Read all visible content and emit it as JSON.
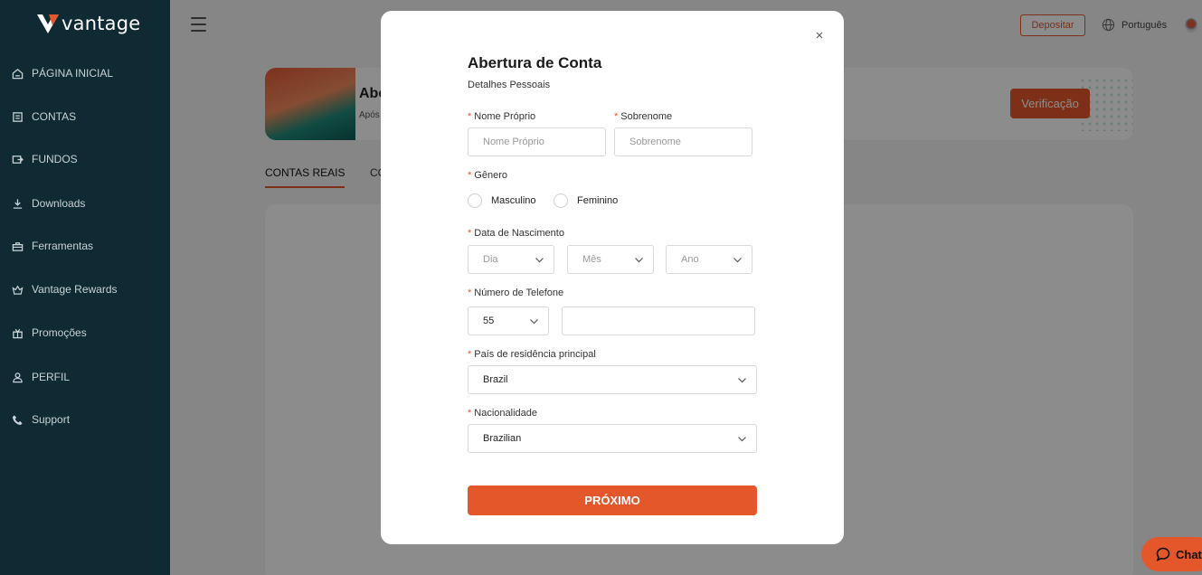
{
  "brand": {
    "name": "vantage"
  },
  "sidebar": {
    "items": [
      {
        "label": "PÁGINA INICIAL",
        "icon": "home-icon"
      },
      {
        "label": "CONTAS",
        "icon": "accounts-icon"
      },
      {
        "label": "FUNDOS",
        "icon": "funds-icon"
      },
      {
        "label": "Downloads",
        "icon": "download-icon"
      },
      {
        "label": "Ferramentas",
        "icon": "tools-icon"
      },
      {
        "label": "Vantage Rewards",
        "icon": "rewards-icon"
      },
      {
        "label": "Promoções",
        "icon": "gift-icon"
      },
      {
        "label": "PERFIL",
        "icon": "user-icon"
      },
      {
        "label": "Support",
        "icon": "phone-icon"
      }
    ]
  },
  "topbar": {
    "deposit_label": "Depositar",
    "language": "Português"
  },
  "banner": {
    "title": "Abe",
    "subtitle": "Após",
    "verify_label": "Verificação"
  },
  "tabs": [
    {
      "label": "CONTAS REAIS"
    },
    {
      "label": "CO"
    }
  ],
  "chat": {
    "label": "Chat"
  },
  "modal": {
    "title": "Abertura de Conta",
    "subtitle": "Detalhes Pessoais",
    "close_icon": "×",
    "first_name": {
      "label": "Nome Próprio",
      "placeholder": "Nome Próprio"
    },
    "last_name": {
      "label": "Sobrenome",
      "placeholder": "Sobrenome"
    },
    "gender": {
      "label": "Gênero",
      "options": [
        "Masculino",
        "Feminino"
      ]
    },
    "dob": {
      "label": "Data de Nascimento",
      "day": "Dia",
      "month": "Mês",
      "year": "Ano"
    },
    "phone": {
      "label": "Número de Telefone",
      "code": "55",
      "number": ""
    },
    "country": {
      "label": "País de residência principal",
      "value": "Brazil"
    },
    "nationality": {
      "label": "Nacionalidade",
      "value": "Brazilian"
    },
    "required_mark": "*",
    "next_label": "PRÓXIMO"
  },
  "colors": {
    "accent": "#e4572a",
    "sidebar": "#0f2a33"
  }
}
